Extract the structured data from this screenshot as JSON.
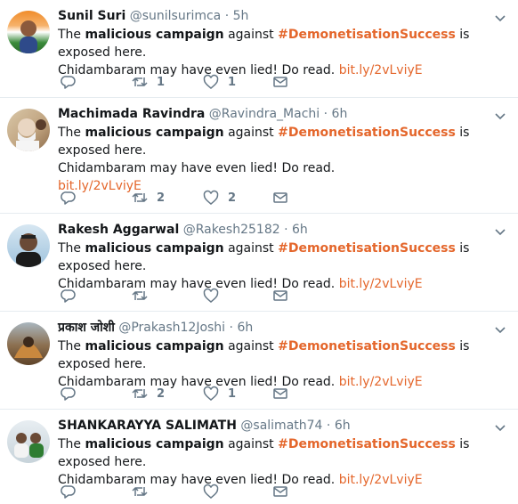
{
  "tweets": [
    {
      "name": "Sunil Suri",
      "handle": "@sunilsurimca",
      "time": "5h",
      "pre": "The ",
      "bold1": "malicious campaign",
      "mid": " against ",
      "hashtag": "#DemonetisationSuccess",
      "post": " is exposed here.",
      "line2": "Chidambaram may have even lied! Do read. ",
      "link": "bit.ly/2vLviyE",
      "replies": "",
      "retweets": "1",
      "likes": "1"
    },
    {
      "name": "Machimada Ravindra",
      "handle": "@Ravindra_Machi",
      "time": "6h",
      "pre": "The ",
      "bold1": "malicious campaign",
      "mid": " against ",
      "hashtag": "#DemonetisationSuccess",
      "post": " is exposed here.",
      "line2": "Chidambaram may have even lied! Do read.",
      "link": "bit.ly/2vLviyE",
      "replies": "",
      "retweets": "2",
      "likes": "2"
    },
    {
      "name": "Rakesh Aggarwal",
      "handle": "@Rakesh25182",
      "time": "6h",
      "pre": "The ",
      "bold1": "malicious campaign",
      "mid": " against ",
      "hashtag": "#DemonetisationSuccess",
      "post": " is exposed here.",
      "line2": "Chidambaram may have even lied! Do read. ",
      "link": "bit.ly/2vLviyE",
      "replies": "",
      "retweets": "",
      "likes": ""
    },
    {
      "name": "प्रकाश जोशी",
      "handle": "@Prakash12Joshi",
      "time": "6h",
      "pre": "The ",
      "bold1": "malicious campaign",
      "mid": " against ",
      "hashtag": "#DemonetisationSuccess",
      "post": " is exposed here.",
      "line2": "Chidambaram may have even lied! Do read. ",
      "link": "bit.ly/2vLviyE",
      "replies": "",
      "retweets": "2",
      "likes": "1"
    },
    {
      "name": "SHANKARAYYA SALIMATH",
      "handle": "@salimath74",
      "time": "6h",
      "pre": "The ",
      "bold1": "malicious campaign",
      "mid": " against ",
      "hashtag": "#DemonetisationSuccess",
      "post": " is exposed here.",
      "line2": "Chidambaram may have even lied! Do read. ",
      "link": "bit.ly/2vLviyE",
      "replies": "",
      "retweets": "",
      "likes": ""
    }
  ],
  "colors": {
    "accent": "#e4662b",
    "muted": "#657786",
    "text": "#14171a"
  },
  "icons": [
    "reply-icon",
    "retweet-icon",
    "like-icon",
    "direct-message-icon",
    "chevron-down-icon"
  ]
}
